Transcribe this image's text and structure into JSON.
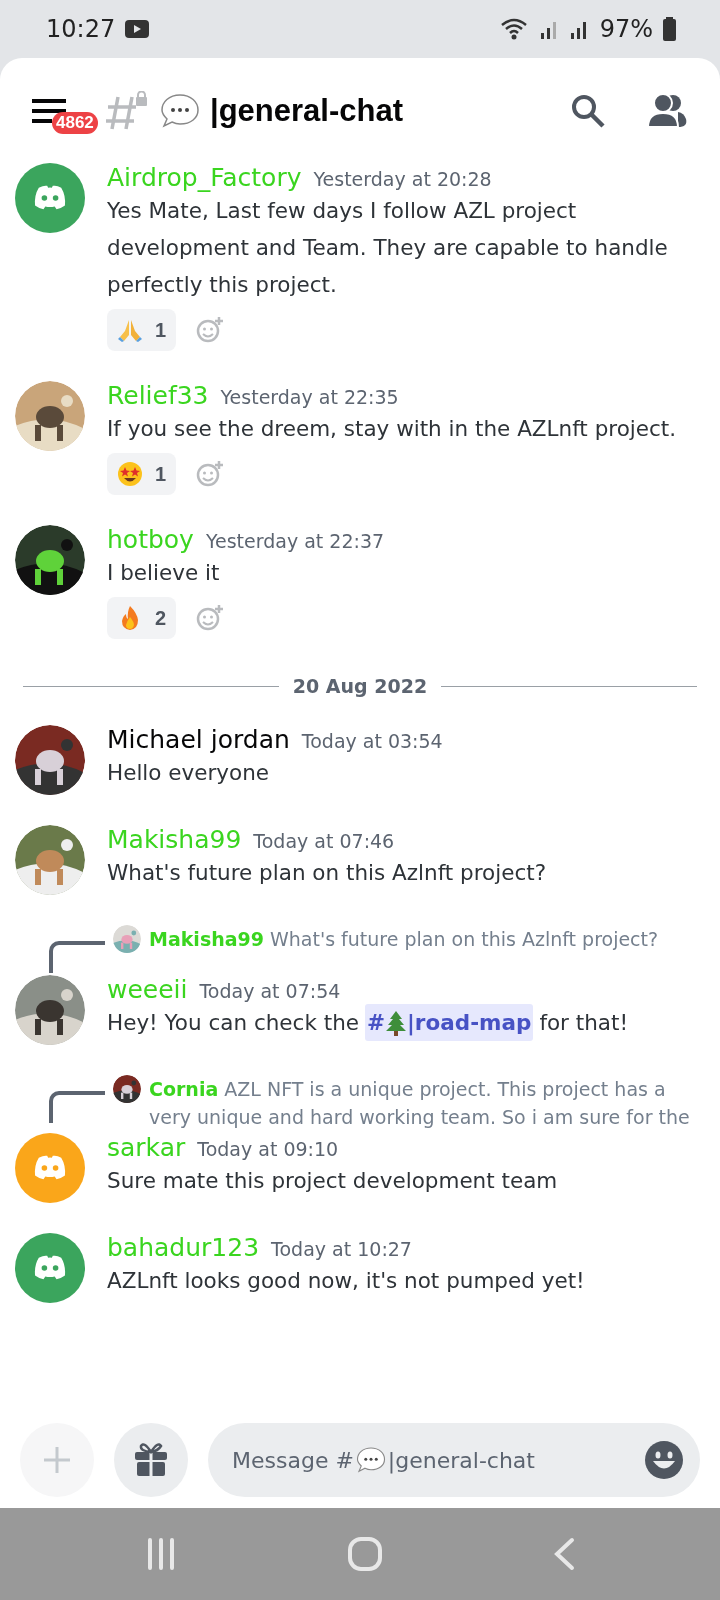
{
  "status_bar": {
    "time": "10:27",
    "battery": "97%"
  },
  "header": {
    "badge": "4862",
    "channel": "|general-chat"
  },
  "messages": [
    {
      "author": "Airdrop_Factory",
      "color": "#3ad51f",
      "avatar": {
        "kind": "discord",
        "color": "#3ba55d"
      },
      "time": "Yesterday at 20:28",
      "text": "Yes Mate, Last few days I follow AZL project development and Team. They are capable to handle perfectly this project.",
      "reactions": [
        {
          "kind": "pray",
          "count": "1"
        }
      ]
    },
    {
      "author": "Relief33",
      "color": "#3ad51f",
      "time": "Yesterday at 22:35",
      "text": "If you see the dreem, stay with in the AZLnft project.",
      "reactions": [
        {
          "kind": "star-eyes",
          "count": "1"
        }
      ]
    },
    {
      "author": "hotboy",
      "color": "#3ad51f",
      "time": "Yesterday at 22:37",
      "text": "I believe it",
      "reactions": [
        {
          "kind": "fire",
          "count": "2"
        }
      ]
    },
    {
      "divider": "20 Aug 2022"
    },
    {
      "author": "Michael jordan",
      "color": "#060607",
      "time": "Today at 03:54",
      "text": "Hello everyone"
    },
    {
      "author": "Makisha99",
      "color": "#3ad51f",
      "time": "Today at 07:46",
      "text": "What's future plan on this Azlnft project?"
    },
    {
      "reply": {
        "author": "Makisha99",
        "text": "What's future plan on this Azlnft project?"
      },
      "author": "weeeii",
      "color": "#3ad51f",
      "time": "Today at 07:54",
      "text": "Hey! You can check the",
      "mention": {
        "prefix": "#",
        "name": "|road-map"
      },
      "after": "for that!"
    },
    {
      "reply": {
        "author": "Cornia",
        "text": "AZL NFT is a unique project. This project has a very unique and hard working team. So i am sure for the"
      },
      "author": "sarkar",
      "color": "#3ad51f",
      "avatar": {
        "kind": "discord",
        "color": "#faa61a"
      },
      "time": "Today at 09:10",
      "text": "Sure mate this project development team"
    },
    {
      "author": "bahadur123",
      "color": "#3ad51f",
      "avatar": {
        "kind": "discord",
        "color": "#3ba55d"
      },
      "time": "Today at 10:27",
      "text": "AZLnft looks good now, it's not pumped yet!"
    }
  ],
  "composer": {
    "placeholder_prefix": "Message #",
    "placeholder_channel": "|general-chat"
  }
}
